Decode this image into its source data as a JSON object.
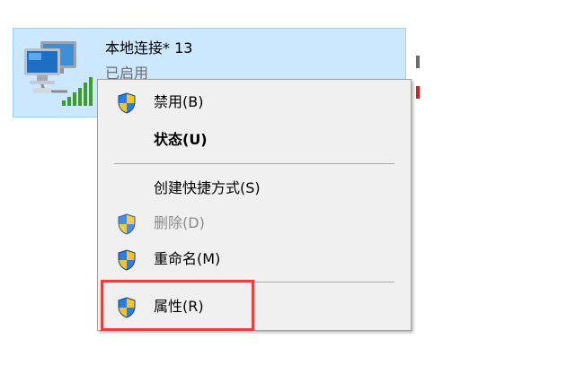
{
  "adapter": {
    "name": "本地连接* 13",
    "status": "已启用",
    "icon": "network-adapter-icon",
    "signal_icon": "signal-bars-icon",
    "tile_color": "#cce8ff"
  },
  "context_menu": {
    "items": [
      {
        "label": "禁用(B)",
        "icon": "uac-shield-icon",
        "enabled": true,
        "bold": false
      },
      {
        "label": "状态(U)",
        "icon": null,
        "enabled": true,
        "bold": true
      },
      {
        "label": "创建快捷方式(S)",
        "icon": null,
        "enabled": true,
        "bold": false
      },
      {
        "label": "删除(D)",
        "icon": "uac-shield-icon",
        "enabled": false,
        "bold": false
      },
      {
        "label": "重命名(M)",
        "icon": "uac-shield-icon",
        "enabled": true,
        "bold": false
      },
      {
        "label": "属性(R)",
        "icon": "uac-shield-icon",
        "enabled": true,
        "bold": false
      }
    ]
  },
  "annotation": {
    "highlight_target": "属性(R)",
    "color": "#e8403a"
  }
}
